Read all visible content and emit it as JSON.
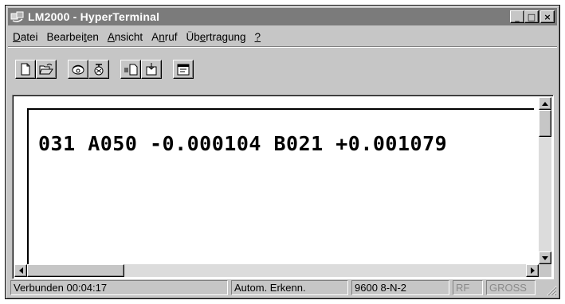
{
  "window": {
    "title": "LM2000 - HyperTerminal",
    "controls": {
      "minimize": "_",
      "maximize": "□",
      "close": "×"
    }
  },
  "menu": {
    "items": [
      {
        "pre": "",
        "ul": "D",
        "post": "atei"
      },
      {
        "pre": "Bearbei",
        "ul": "t",
        "post": "en"
      },
      {
        "pre": "",
        "ul": "A",
        "post": "nsicht"
      },
      {
        "pre": "A",
        "ul": "n",
        "post": "ruf"
      },
      {
        "pre": "Üb",
        "ul": "e",
        "post": "rtragung"
      },
      {
        "pre": "",
        "ul": "?",
        "post": ""
      }
    ]
  },
  "toolbar": {
    "buttons": [
      {
        "icon": "new-document-icon"
      },
      {
        "icon": "open-folder-icon"
      },
      {
        "icon": "connect-phone-icon"
      },
      {
        "icon": "disconnect-phone-icon"
      },
      {
        "icon": "send-file-icon"
      },
      {
        "icon": "receive-file-icon"
      },
      {
        "icon": "properties-icon"
      }
    ]
  },
  "terminal": {
    "line": "031 A050 -0.000104 B021 +0.001079"
  },
  "statusbar": {
    "connected": "Verbunden 00:04:17",
    "detect": "Autom. Erkenn.",
    "settings": "9600 8-N-2",
    "rf": "RF",
    "caps": "GROSS"
  }
}
